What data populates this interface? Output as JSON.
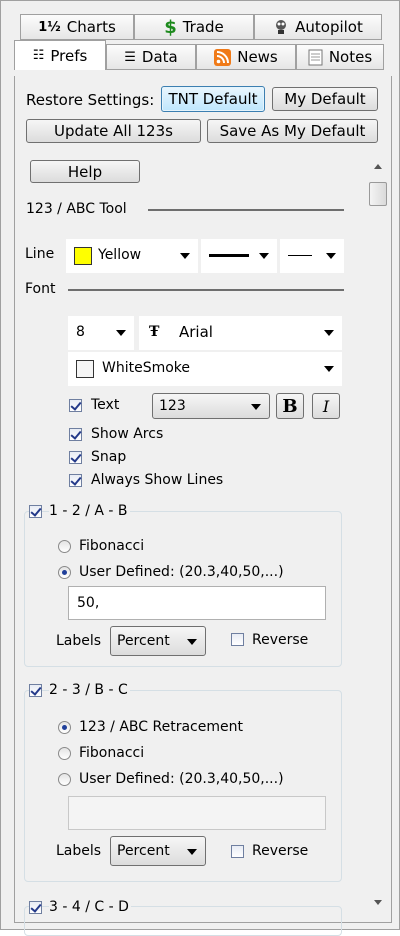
{
  "tabs_row1": [
    {
      "label": "Charts",
      "icon": "chart-icon"
    },
    {
      "label": "Trade",
      "icon": "dollar-icon"
    },
    {
      "label": "Autopilot",
      "icon": "autopilot-icon"
    }
  ],
  "tabs_row2": [
    {
      "label": "Prefs",
      "icon": "prefs-icon"
    },
    {
      "label": "Data",
      "icon": "data-icon"
    },
    {
      "label": "News",
      "icon": "rss-icon"
    },
    {
      "label": "Notes",
      "icon": "notes-icon"
    }
  ],
  "restore": {
    "label": "Restore Settings:",
    "tnt_default": "TNT Default",
    "my_default": "My Default"
  },
  "update_all": "Update All 123s",
  "save_default": "Save As My Default",
  "help": "Help",
  "tool_title": "123 / ABC Tool",
  "line": {
    "label": "Line",
    "color": "Yellow",
    "color_hex": "#ffff00"
  },
  "font": {
    "label": "Font",
    "size": "8",
    "family": "Arial",
    "color": "WhiteSmoke",
    "color_hex": "#f5f5f5",
    "text_label": "Text",
    "text_value": "123",
    "bold": "B",
    "italic": "I"
  },
  "options": {
    "show_arcs": "Show Arcs",
    "snap": "Snap",
    "always_show_lines": "Always Show Lines"
  },
  "section1": {
    "title": "1 - 2 / A - B",
    "fibonacci": "Fibonacci",
    "user_defined": "User Defined: (20.3,40,50,...)",
    "user_value": "50,",
    "labels": "Labels",
    "labels_value": "Percent",
    "reverse": "Reverse"
  },
  "section2": {
    "title": "2 - 3 / B - C",
    "retracement": "123 / ABC Retracement",
    "fibonacci": "Fibonacci",
    "user_defined": "User Defined: (20.3,40,50,...)",
    "user_value": "",
    "labels": "Labels",
    "labels_value": "Percent",
    "reverse": "Reverse"
  },
  "section3": {
    "title": "3 - 4 / C - D"
  }
}
